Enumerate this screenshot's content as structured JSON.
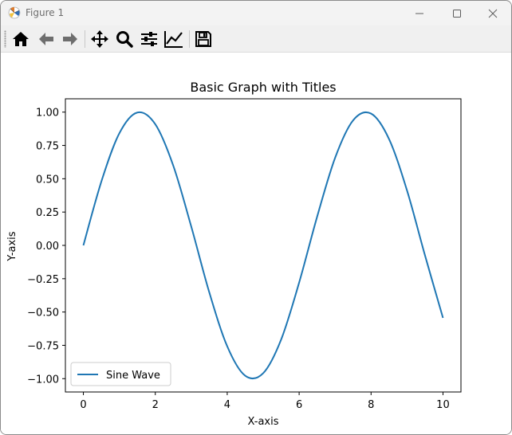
{
  "window": {
    "title": "Figure 1"
  },
  "toolbar": {
    "buttons": [
      {
        "name": "home-icon"
      },
      {
        "name": "back-icon"
      },
      {
        "name": "forward-icon"
      },
      {
        "name": "pan-icon"
      },
      {
        "name": "zoom-icon"
      },
      {
        "name": "subplots-icon"
      },
      {
        "name": "axes-edit-icon"
      },
      {
        "name": "save-icon"
      }
    ]
  },
  "chart_data": {
    "type": "line",
    "title": "Basic Graph with Titles",
    "xlabel": "X-axis",
    "ylabel": "Y-axis",
    "xlim": [
      -0.5,
      10.5
    ],
    "ylim": [
      -1.1,
      1.1
    ],
    "x_ticks": [
      0,
      2,
      4,
      6,
      8,
      10
    ],
    "x_tick_labels": [
      "0",
      "2",
      "4",
      "6",
      "8",
      "10"
    ],
    "y_ticks": [
      1.0,
      0.75,
      0.5,
      0.25,
      0.0,
      -0.25,
      -0.5,
      -0.75,
      -1.0
    ],
    "y_tick_labels": [
      "1.00",
      "0.75",
      "0.50",
      "0.25",
      "0.00",
      "−0.25",
      "−0.50",
      "−0.75",
      "−1.00"
    ],
    "grid": false,
    "legend_position": "lower-left",
    "series": [
      {
        "name": "Sine Wave",
        "color": "#1f77b4",
        "x": [
          0,
          0.5,
          1,
          1.5,
          2,
          2.5,
          3,
          3.5,
          4,
          4.5,
          5,
          5.5,
          6,
          6.5,
          7,
          7.5,
          8,
          8.5,
          9,
          9.5,
          10
        ],
        "y": [
          0.0,
          0.479,
          0.841,
          0.997,
          0.909,
          0.598,
          0.141,
          -0.351,
          -0.757,
          -0.978,
          -0.959,
          -0.706,
          -0.279,
          0.215,
          0.657,
          0.938,
          0.989,
          0.798,
          0.412,
          -0.075,
          -0.544
        ]
      }
    ]
  }
}
